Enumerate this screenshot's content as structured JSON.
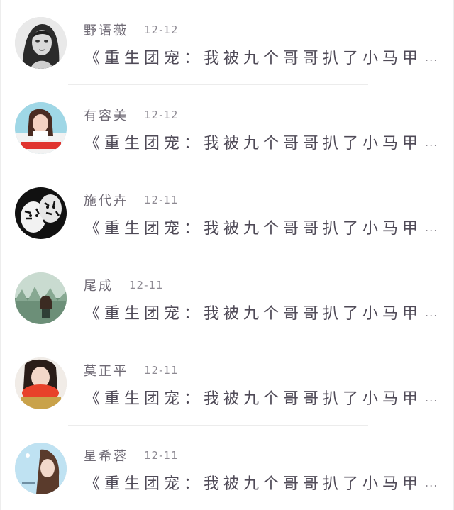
{
  "messages": [
    {
      "name": "野语薇",
      "date": "12-12",
      "text": "《重生团宠：我被九个哥哥扒了小马甲",
      "more": "...",
      "avatar_icon": "avatar-woman-sketch-icon"
    },
    {
      "name": "有容美",
      "date": "12-12",
      "text": "《重生团宠：我被九个哥哥扒了小马甲",
      "more": "...",
      "avatar_icon": "avatar-girl-photo-icon"
    },
    {
      "name": "施代卉",
      "date": "12-11",
      "text": "《重生团宠：我被九个哥哥扒了小马甲",
      "more": "...",
      "avatar_icon": "avatar-tigers-icon"
    },
    {
      "name": "尾成",
      "date": "12-11",
      "text": "《重生团宠：我被九个哥哥扒了小马甲",
      "more": "...",
      "avatar_icon": "avatar-forest-girl-icon"
    },
    {
      "name": "莫正平",
      "date": "12-11",
      "text": "《重生团宠：我被九个哥哥扒了小马甲",
      "more": "...",
      "avatar_icon": "avatar-red-scarf-icon"
    },
    {
      "name": "星希蓉",
      "date": "12-11",
      "text": "《重生团宠：我被九个哥哥扒了小马甲",
      "more": "...",
      "avatar_icon": "avatar-sky-girl-icon"
    }
  ]
}
